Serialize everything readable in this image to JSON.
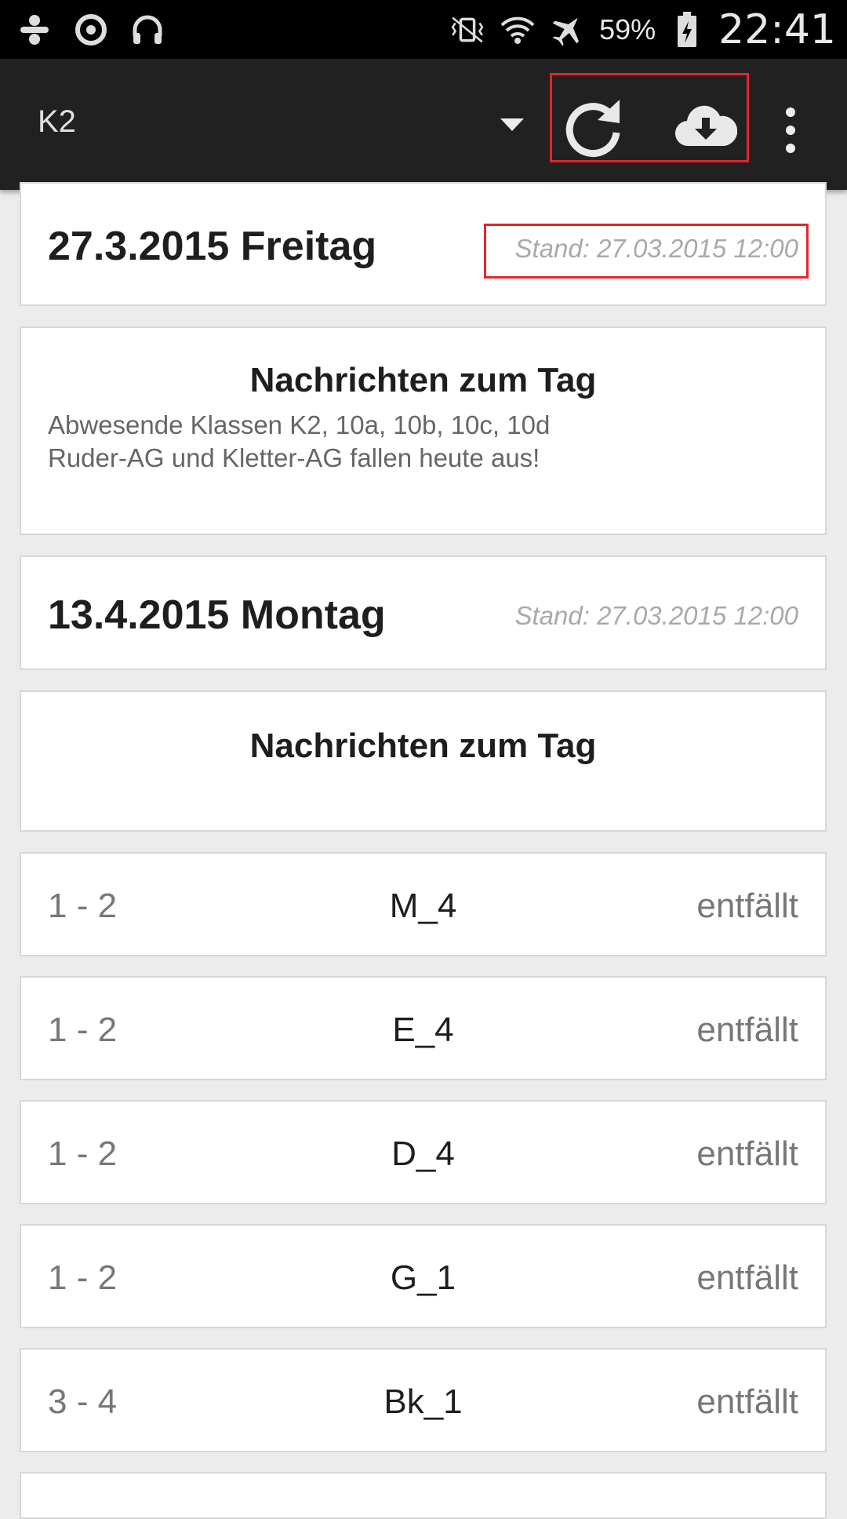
{
  "status_bar": {
    "icons_left": [
      "usb-debug-icon",
      "sync-app-icon",
      "headset-icon"
    ],
    "icons_right": [
      "vibrate-icon",
      "wifi-icon",
      "airplane-icon",
      "battery-charging-icon"
    ],
    "battery_percent": "59%",
    "time": "22:41"
  },
  "action_bar": {
    "title": "K2",
    "spinner_icon": "dropdown-arrow-icon",
    "refresh_icon": "refresh-icon",
    "download_icon": "cloud-download-icon",
    "overflow_icon": "overflow-menu-icon",
    "highlight_color": "#e0262c"
  },
  "days": [
    {
      "title": "27.3.2015 Freitag",
      "stand": "Stand: 27.03.2015 12:00",
      "messages_title": "Nachrichten zum Tag",
      "messages": [
        "Abwesende Klassen K2, 10a, 10b, 10c, 10d",
        "Ruder-AG und Kletter-AG fallen heute aus!"
      ]
    },
    {
      "title": "13.4.2015 Montag",
      "stand": "Stand: 27.03.2015 12:00",
      "messages_title": "Nachrichten zum Tag",
      "messages": []
    }
  ],
  "entries": [
    {
      "period": "1 - 2",
      "subject": "M_4",
      "status": "entfällt"
    },
    {
      "period": "1 - 2",
      "subject": "E_4",
      "status": "entfällt"
    },
    {
      "period": "1 - 2",
      "subject": "D_4",
      "status": "entfällt"
    },
    {
      "period": "1 - 2",
      "subject": "G_1",
      "status": "entfällt"
    },
    {
      "period": "3 - 4",
      "subject": "Bk_1",
      "status": "entfällt"
    }
  ]
}
